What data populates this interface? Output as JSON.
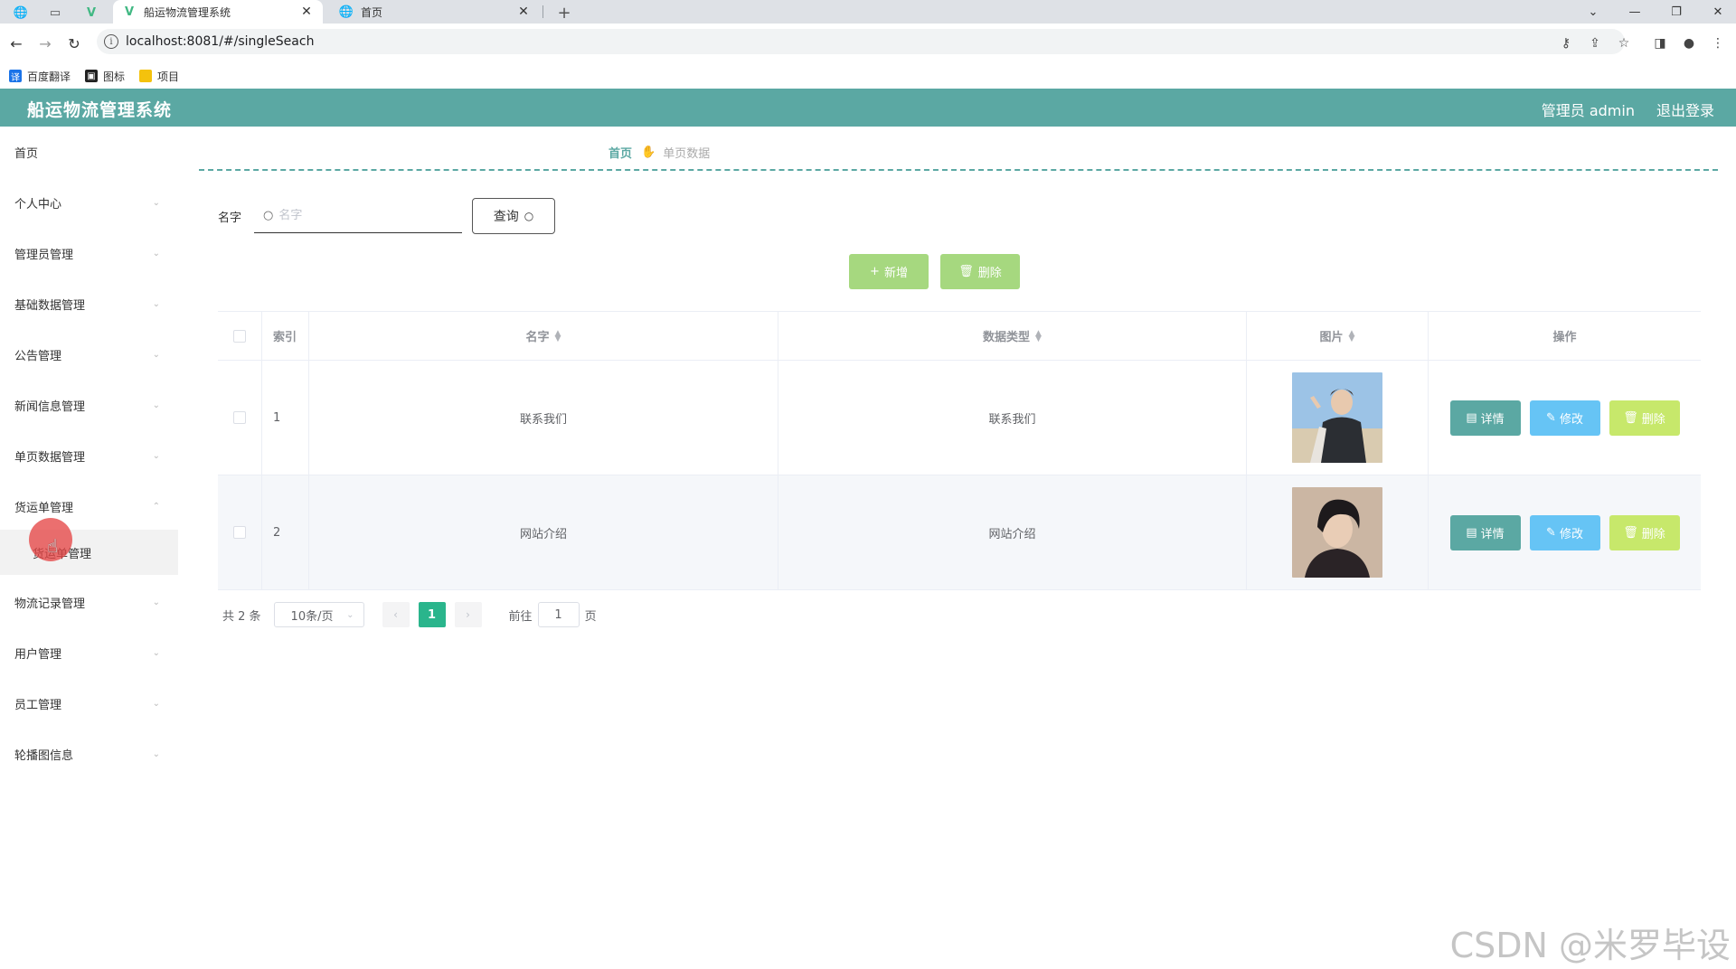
{
  "browser": {
    "tabs": [
      {
        "title": "船运物流管理系统",
        "active": true
      },
      {
        "title": "首页",
        "active": false
      }
    ],
    "new_tab": "+",
    "url": "localhost:8081/#/singleSeach",
    "bookmarks": [
      {
        "label": "百度翻译",
        "icon": "translate-icon",
        "color": "#1a73e8"
      },
      {
        "label": "图标",
        "icon": "image-icon",
        "color": "#222222"
      },
      {
        "label": "项目",
        "icon": "folder-icon",
        "color": "#f4c20d"
      }
    ]
  },
  "header": {
    "title": "船运物流管理系统",
    "user": "管理员 admin",
    "logout": "退出登录",
    "color": "#5ba8a3"
  },
  "sidebar": {
    "items": [
      {
        "label": "首页",
        "expandable": false
      },
      {
        "label": "个人中心",
        "expandable": true
      },
      {
        "label": "管理员管理",
        "expandable": true
      },
      {
        "label": "基础数据管理",
        "expandable": true
      },
      {
        "label": "公告管理",
        "expandable": true
      },
      {
        "label": "新闻信息管理",
        "expandable": true
      },
      {
        "label": "单页数据管理",
        "expandable": true
      },
      {
        "label": "货运单管理",
        "expandable": true,
        "expanded": true
      },
      {
        "label": "物流记录管理",
        "expandable": true
      },
      {
        "label": "用户管理",
        "expandable": true
      },
      {
        "label": "员工管理",
        "expandable": true
      },
      {
        "label": "轮播图信息",
        "expandable": true
      }
    ],
    "sub_item": "货运单管理"
  },
  "breadcrumb": {
    "home": "首页",
    "current": "单页数据"
  },
  "search": {
    "label": "名字",
    "placeholder": "名字",
    "value": "",
    "button": "查询"
  },
  "toolbar": {
    "add": "新增",
    "delete": "删除",
    "color": "#a6d87f"
  },
  "table": {
    "columns": [
      "索引",
      "名字",
      "数据类型",
      "图片",
      "操作"
    ],
    "rows": [
      {
        "index": "1",
        "name": "联系我们",
        "type": "联系我们",
        "image": "portrait-photo-1"
      },
      {
        "index": "2",
        "name": "网站介绍",
        "type": "网站介绍",
        "image": "portrait-photo-2"
      }
    ],
    "actions": {
      "detail": "详情",
      "edit": "修改",
      "delete": "删除"
    }
  },
  "pagination": {
    "total": "共 2 条",
    "page_size": "10条/页",
    "current_page": "1",
    "goto_label": "前往",
    "goto_value": "1",
    "page_suffix": "页",
    "active_color": "#2ab58c"
  },
  "watermark": "CSDN @米罗毕设"
}
